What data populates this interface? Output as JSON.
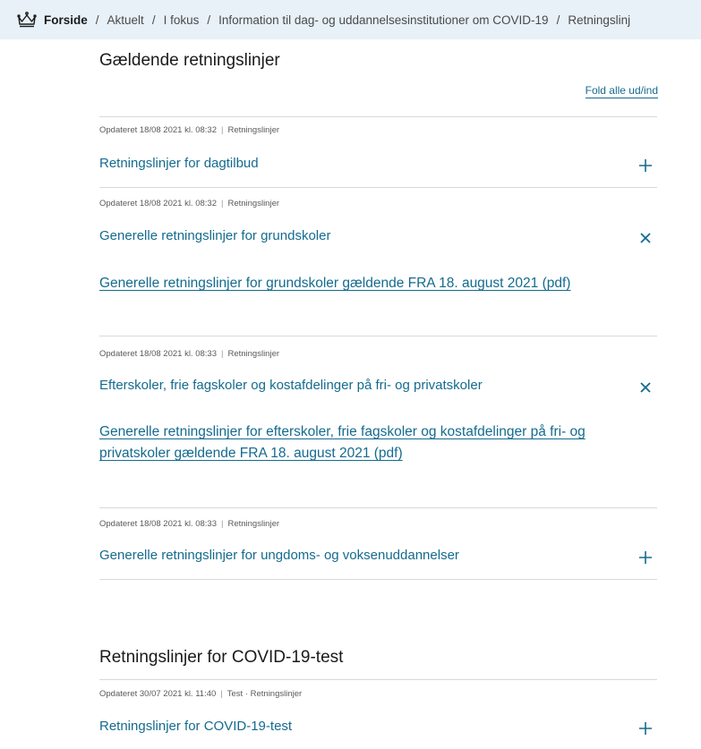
{
  "breadcrumb": {
    "home": "Forside",
    "items": [
      "Aktuelt",
      "I fokus",
      "Information til dag- og uddannelsesinstitutioner om COVID-19",
      "Retningslinj"
    ],
    "separator": "/"
  },
  "section1": {
    "title": "Gældende retningslinjer",
    "fold_all": "Fold alle ud/ind",
    "items": [
      {
        "meta_date": "Opdateret 18/08 2021 kl. 08:32",
        "meta_tag": "Retningslinjer",
        "title": "Retningslinjer for dagtilbud",
        "expanded": false
      },
      {
        "meta_date": "Opdateret 18/08 2021 kl. 08:32",
        "meta_tag": "Retningslinjer",
        "title": "Generelle retningslinjer for grundskoler",
        "expanded": true,
        "link": "Generelle retningslinjer for grundskoler gældende FRA 18. august 2021 (pdf)"
      },
      {
        "meta_date": "Opdateret 18/08 2021 kl. 08:33",
        "meta_tag": "Retningslinjer",
        "title": "Efterskoler, frie fagskoler og kostafdelinger på fri- og privatskoler",
        "expanded": true,
        "link": "Generelle retningslinjer for efterskoler, frie fagskoler og kostafdelinger på fri- og privatskoler gældende FRA 18. august 2021 (pdf)"
      },
      {
        "meta_date": "Opdateret 18/08 2021 kl. 08:33",
        "meta_tag": "Retningslinjer",
        "title": "Generelle retningslinjer for ungdoms- og voksenuddannelser",
        "expanded": false
      }
    ]
  },
  "section2": {
    "title": "Retningslinjer for COVID-19-test",
    "items": [
      {
        "meta_date": "Opdateret 30/07 2021 kl. 11:40",
        "meta_tag": "Test · Retningslinjer",
        "title": "Retningslinjer for COVID-19-test",
        "expanded": false
      }
    ]
  },
  "colors": {
    "link": "#146b8e",
    "breadcrumb_bg": "#e8f1f8",
    "divider": "#d9d9d9"
  },
  "icons": {
    "home": "crown-icon",
    "expand": "plus-icon",
    "collapse": "close-icon"
  }
}
